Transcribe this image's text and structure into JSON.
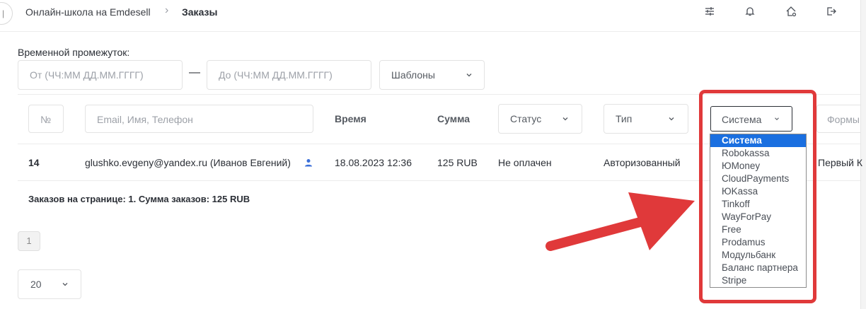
{
  "breadcrumb": {
    "home": "Онлайн-школа на Emdesell",
    "separator": "›",
    "current": "Заказы"
  },
  "topbar_icons": [
    "sliders-icon",
    "bell-icon",
    "home-settings-icon",
    "logout-icon"
  ],
  "filters": {
    "time_label": "Временной промежуток:",
    "from_placeholder": "От (ЧЧ:ММ ДД.ММ.ГГГГ)",
    "dash": "—",
    "to_placeholder": "До (ЧЧ:ММ ДД.ММ.ГГГГ)",
    "templates": "Шаблоны"
  },
  "table": {
    "headers": {
      "number": "№",
      "search_placeholder": "Email, Имя, Телефон",
      "time": "Время",
      "amount": "Сумма",
      "status": "Статус",
      "type": "Тип",
      "system": "Система",
      "forms": "Формы"
    },
    "rows": [
      {
        "number": "14",
        "customer": "glushko.evgeny@yandex.ru (Иванов Евгений)",
        "time": "18.08.2023 12:36",
        "amount": "125 RUB",
        "status": "Не оплачен",
        "type": "Авторизованный",
        "form": "Первый К"
      }
    ]
  },
  "summary": "Заказов на странице: 1. Сумма заказов: 125 RUB",
  "pagination": {
    "current_page": "1",
    "page_size": "20"
  },
  "system_dropdown": {
    "selected": "Система",
    "options": [
      "Система",
      "Robokassa",
      "ЮMoney",
      "CloudPayments",
      "ЮKassa",
      "Tinkoff",
      "WayForPay",
      "Free",
      "Prodamus",
      "Модульбанк",
      "Баланс партнера",
      "Stripe"
    ]
  },
  "colors": {
    "accent_blue": "#1a6fe0",
    "highlight_red": "#e0393a",
    "user_icon": "#3b6fd8"
  }
}
